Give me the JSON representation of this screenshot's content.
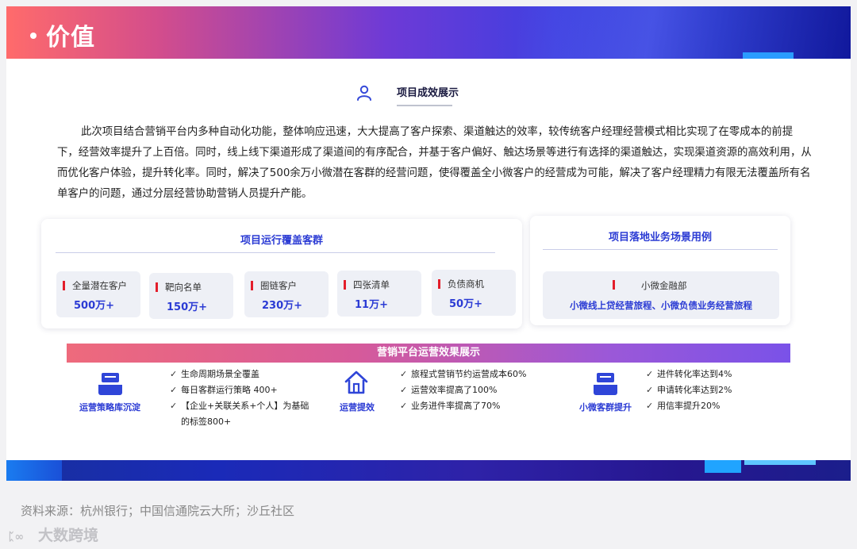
{
  "header": {
    "title": "价值"
  },
  "section": {
    "title": "项目成效展示",
    "icon": "person-icon"
  },
  "paragraph": "此次项目结合营销平台内多种自动化功能，整体响应迅速，大大提高了客户探索、渠道触达的效率，较传统客户经理经营模式相比实现了在零成本的前提下，经营效率提升了上百倍。同时，线上线下渠道形成了渠道间的有序配合，并基于客户偏好、触达场景等进行有选择的渠道触达，实现渠道资源的高效利用，从而优化客户体验，提升转化率。同时，解决了500余万小微潜在客群的经营问题，使得覆盖全小微客户的经营成为可能，解决了客户经理精力有限无法覆盖所有名单客户的问题，通过分层经营协助营销人员提升产能。",
  "coverage": {
    "title": "项目运行覆盖客群",
    "items": [
      {
        "label": "全量潜在客户",
        "value": "500万+"
      },
      {
        "label": "靶向名单",
        "value": "150万+"
      },
      {
        "label": "圈链客户",
        "value": "230万+"
      },
      {
        "label": "四张清单",
        "value": "11万+"
      },
      {
        "label": "负债商机",
        "value": "50万+"
      }
    ]
  },
  "cases": {
    "title": "项目落地业务场景用例",
    "label": "小微金融部",
    "value": "小微线上贷经营旅程、小微负债业务经营旅程"
  },
  "effects": {
    "title": "营销平台运营效果展示",
    "columns": [
      {
        "name": "运营策略库沉淀",
        "icon": "inbox-tray-icon",
        "checks": [
          "生命周期场景全覆盖",
          "每日客群运行策略 400+",
          "【企业+关联关系+个人】为基础"
        ],
        "continuation": "的标签800+"
      },
      {
        "name": "运营提效",
        "icon": "house-icon",
        "checks": [
          "旅程式营销节约运营成本60%",
          "运营效率提高了100%",
          "业务进件率提高了70%"
        ]
      },
      {
        "name": "小微客群提升",
        "icon": "inbox-tray-icon",
        "checks": [
          "进件转化率达到4%",
          "申请转化率达到2%",
          "用信率提升20%"
        ]
      }
    ]
  },
  "footer": {
    "source": "资料来源：杭州银行；中国信通院云大所；沙丘社区",
    "watermark": "大数跨境"
  },
  "colors": {
    "accent": "#2b3bd4",
    "marker": "#e31e2b"
  }
}
